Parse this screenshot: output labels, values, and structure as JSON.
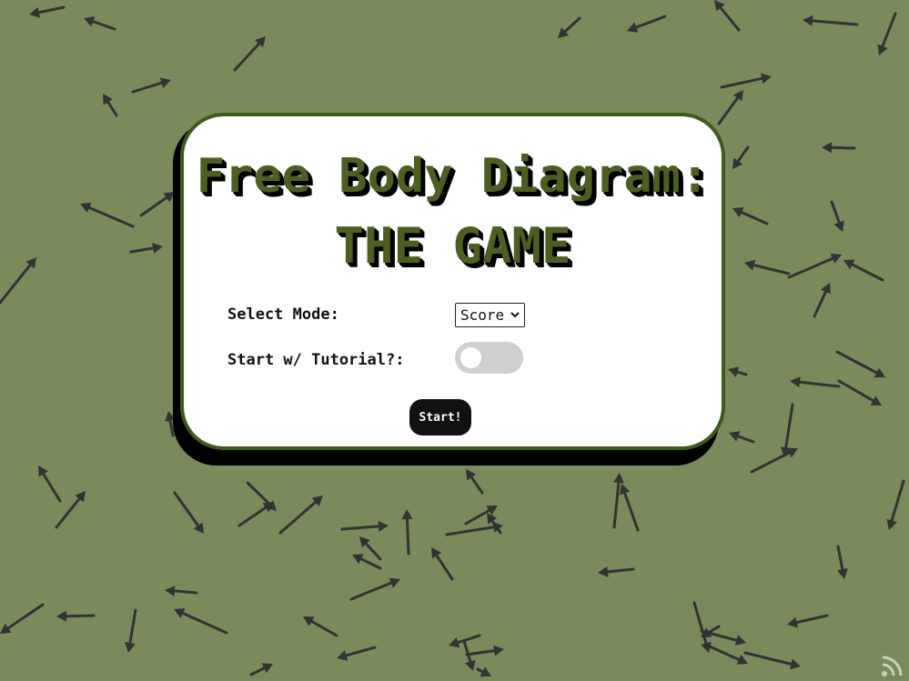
{
  "title": {
    "line1": "Free Body Diagram:",
    "line2": "THE GAME"
  },
  "settings": {
    "mode_label": "Select Mode:",
    "mode_value": "Score",
    "tutorial_label": "Start w/ Tutorial?:",
    "tutorial_enabled": false
  },
  "start_label": "Start!",
  "colors": {
    "background": "#7a8a5b",
    "arrow": "#333333",
    "title": "#4c5e21",
    "card_border": "#3d5a1a"
  },
  "icons": {
    "select_caret": "chevron-down-icon",
    "corner": "rss-feed-icon"
  }
}
